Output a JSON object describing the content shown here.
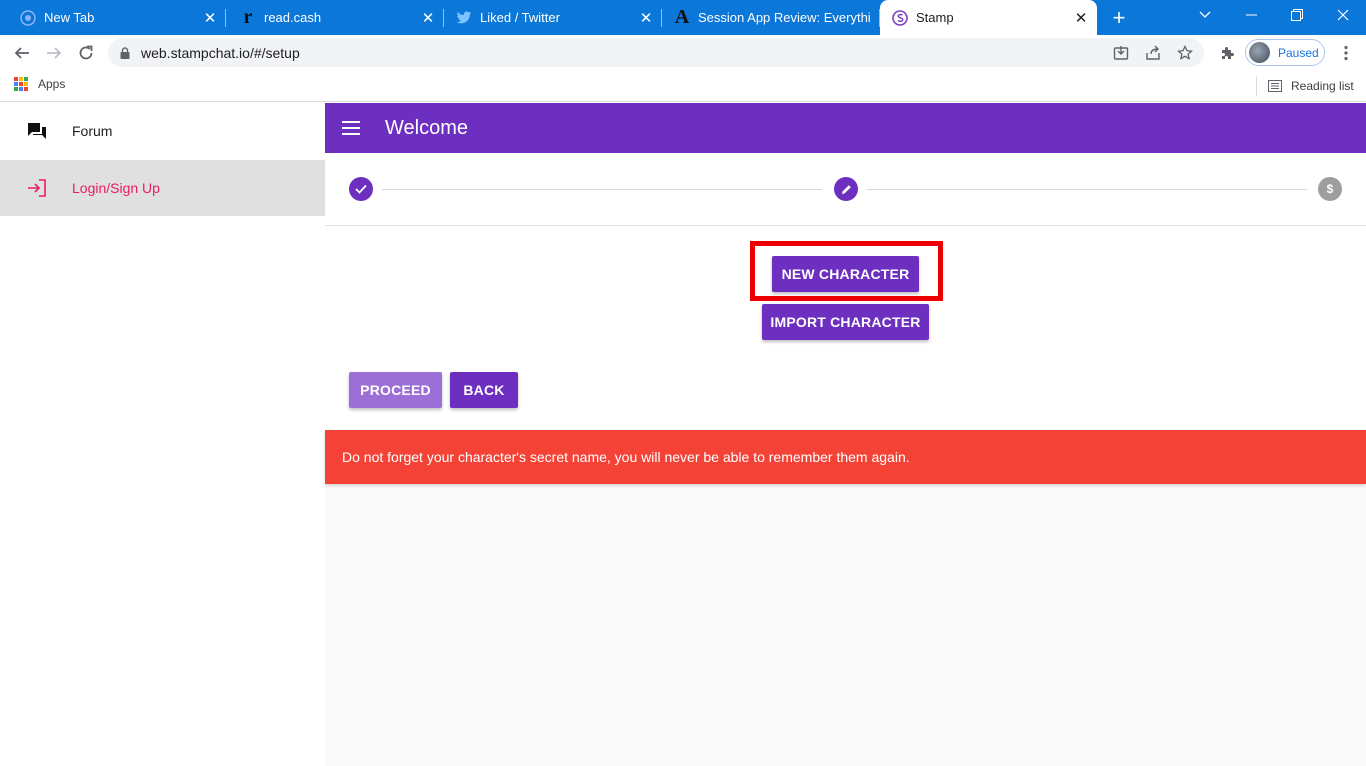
{
  "browser": {
    "tabs": [
      {
        "title": "New Tab",
        "icon": "chrome-icon"
      },
      {
        "title": "read.cash",
        "icon": "readcash-icon"
      },
      {
        "title": "Liked / Twitter",
        "icon": "twitter-icon"
      },
      {
        "title": "Session App Review: Everythi",
        "icon": "a-logo-icon"
      },
      {
        "title": "Stamp",
        "icon": "stamp-icon"
      }
    ],
    "url": "web.stampchat.io/#/setup",
    "profile_label": "Paused",
    "bookmarks": {
      "apps_label": "Apps",
      "reading_list_label": "Reading list"
    }
  },
  "sidebar": {
    "items": [
      {
        "label": "Forum",
        "icon": "forum-icon"
      },
      {
        "label": "Login/Sign Up",
        "icon": "login-icon"
      }
    ]
  },
  "appbar": {
    "title": "Welcome"
  },
  "stepper": {
    "steps": [
      {
        "state": "complete",
        "icon": "check-icon"
      },
      {
        "state": "active",
        "icon": "pencil-icon"
      },
      {
        "state": "pending",
        "icon": "dollar-icon",
        "glyph": "$"
      }
    ]
  },
  "actions": {
    "new_character": "NEW CHARACTER",
    "import_character": "IMPORT CHARACTER",
    "proceed": "PROCEED",
    "back": "BACK"
  },
  "banner": {
    "text": "Do not forget your character's secret name, you will never be able to remember them again."
  },
  "colors": {
    "primary": "#6d2fbf",
    "primary_disabled": "#9c6fd6",
    "danger": "#f44336",
    "accent_pink": "#e91e63",
    "highlight": "#ee0000"
  }
}
